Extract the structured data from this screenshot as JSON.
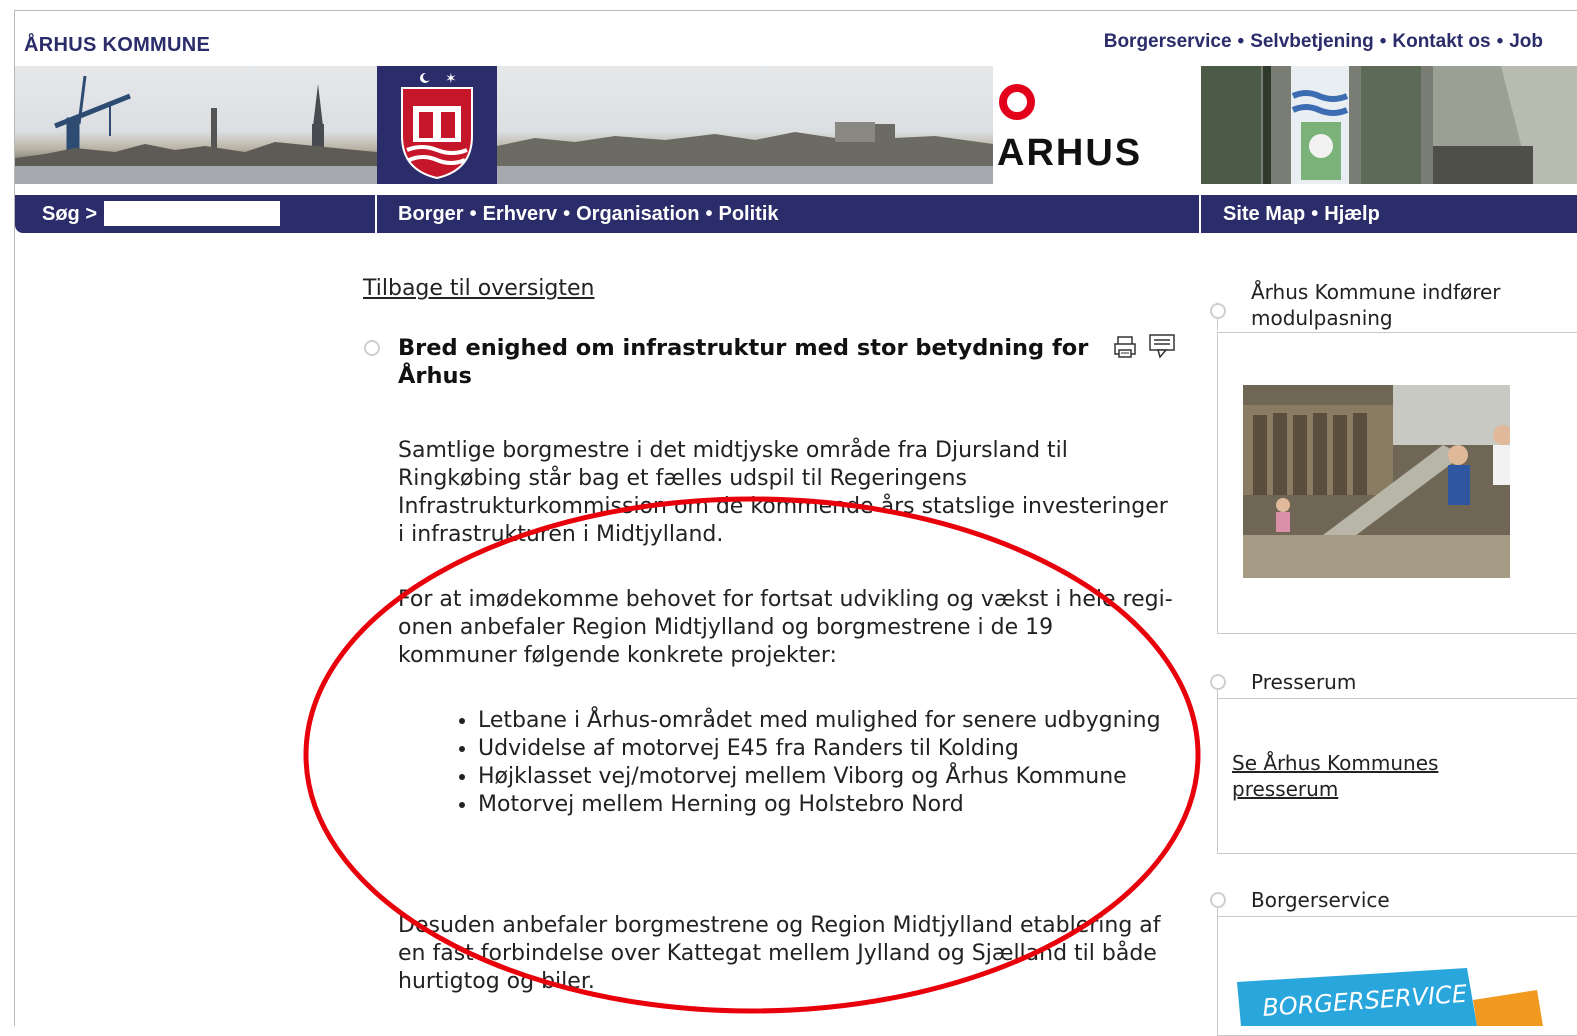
{
  "header": {
    "brand": "ÅRHUS KOMMUNE",
    "top_links": [
      "Borgerservice",
      "Selvbetjening",
      "Kontakt os",
      "Job"
    ],
    "separator": "•",
    "logo_word": "ARHUS"
  },
  "navbar": {
    "search_label": "Søg >",
    "search_value": "",
    "main": [
      "Borger",
      "Erhverv",
      "Organisation",
      "Politik"
    ],
    "site": [
      "Site Map",
      "Hjælp"
    ]
  },
  "article": {
    "back_link": "Tilbage til oversigten",
    "title": "Bred enighed om infrastruktur med stor betydning for Århus",
    "para1": "Samtlige borgmestre i det midtjyske område fra Djursland til Ringkøbing står bag et fælles udspil til Regeringens Infrastrukturkommission om de kommende års statslige investeringer i infrastrukturen i Midtjylland.",
    "para2": "For at imødekomme behovet for fortsat udvikling og vækst i hele regi-onen anbefaler Region Midtjylland og borgmestrene i de 19 kommuner følgende konkrete projekter:",
    "projects": [
      "Letbane i Århus-området med mulighed for senere udbygning",
      "Udvidelse af motorvej E45 fra Randers til Kolding",
      "Højklasset vej/motorvej mellem Viborg og Århus Kommune",
      "Motorvej mellem Herning og Holstebro Nord"
    ],
    "para3": "Desuden anbefaler borgmestrene og Region Midtjylland etablering af en fast forbindelse over Kattegat mellem Jylland og Sjælland til både hurtigtog og biler."
  },
  "sidebar": {
    "news_title": "Århus Kommune indfører modulpasning",
    "press_title": "Presserum",
    "press_link": "Se Århus Kommunes presserum",
    "service_title": "Borgerservice",
    "service_image_text": "BORGERSERVICE"
  },
  "colors": {
    "brand_navy": "#2b2c6a",
    "annotation_red": "#e8000b"
  }
}
